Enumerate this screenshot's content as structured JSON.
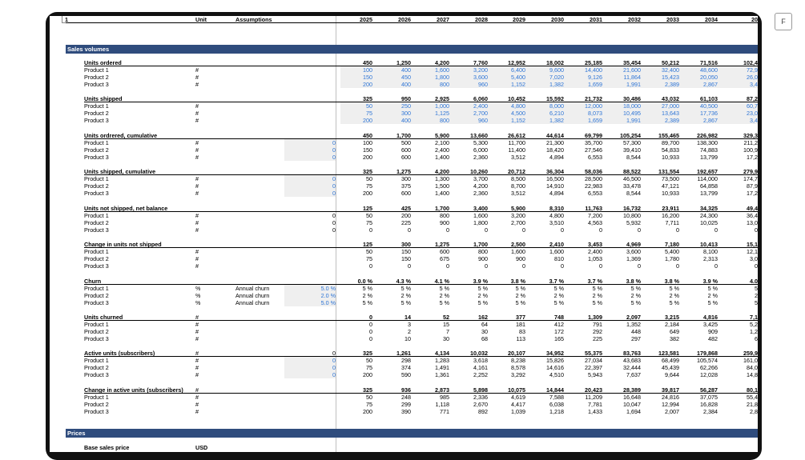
{
  "header": {
    "label0": "1",
    "unit": "Unit",
    "assumptions": "Assumptions",
    "years": [
      "2025",
      "2026",
      "2027",
      "2028",
      "2029",
      "2030",
      "2031",
      "2032",
      "2033",
      "2034",
      "20"
    ]
  },
  "toolbar": {
    "f_label": "F"
  },
  "sections": [
    {
      "label": "Sales volumes"
    },
    {
      "label": "Prices"
    }
  ],
  "blocks": [
    {
      "title": "Units ordered",
      "unit": "",
      "shade_assump": false,
      "shade_data": true,
      "values_blue": true,
      "total": [
        "450",
        "1,250",
        "4,200",
        "7,760",
        "12,952",
        "18,002",
        "25,185",
        "35,454",
        "50,212",
        "71,516",
        "102,4"
      ],
      "rows": [
        {
          "label": "Product 1",
          "unit": "#",
          "assump_label": "",
          "assump": "",
          "v": [
            "100",
            "400",
            "1,600",
            "3,200",
            "6,400",
            "9,600",
            "14,400",
            "21,600",
            "32,400",
            "48,600",
            "72,9"
          ]
        },
        {
          "label": "Product 2",
          "unit": "#",
          "assump_label": "",
          "assump": "",
          "v": [
            "150",
            "450",
            "1,800",
            "3,600",
            "5,400",
            "7,020",
            "9,126",
            "11,864",
            "15,423",
            "20,050",
            "26,0"
          ]
        },
        {
          "label": "Product 3",
          "unit": "#",
          "assump_label": "",
          "assump": "",
          "v": [
            "200",
            "400",
            "800",
            "960",
            "1,152",
            "1,382",
            "1,659",
            "1,991",
            "2,389",
            "2,867",
            "3,4"
          ]
        }
      ]
    },
    {
      "title": "Units shipped",
      "unit": "",
      "shade_assump": false,
      "shade_data": true,
      "values_blue": true,
      "total": [
        "325",
        "950",
        "2,925",
        "6,060",
        "10,452",
        "15,592",
        "21,732",
        "30,486",
        "43,032",
        "61,103",
        "87,2"
      ],
      "rows": [
        {
          "label": "Product 1",
          "unit": "#",
          "assump_label": "",
          "assump": "",
          "v": [
            "50",
            "250",
            "1,000",
            "2,400",
            "4,800",
            "8,000",
            "12,000",
            "18,000",
            "27,000",
            "40,500",
            "60,7"
          ]
        },
        {
          "label": "Product 2",
          "unit": "#",
          "assump_label": "",
          "assump": "",
          "v": [
            "75",
            "300",
            "1,125",
            "2,700",
            "4,500",
            "6,210",
            "8,073",
            "10,495",
            "13,643",
            "17,736",
            "23,0"
          ]
        },
        {
          "label": "Product 3",
          "unit": "#",
          "assump_label": "",
          "assump": "",
          "v": [
            "200",
            "400",
            "800",
            "960",
            "1,152",
            "1,382",
            "1,659",
            "1,991",
            "2,389",
            "2,867",
            "3,4"
          ]
        }
      ]
    },
    {
      "title": "Units ordrered, cumulative",
      "unit": "",
      "shade_assump": true,
      "shade_data": false,
      "values_blue": false,
      "total": [
        "450",
        "1,700",
        "5,900",
        "13,660",
        "26,612",
        "44,614",
        "69,799",
        "105,254",
        "155,465",
        "226,982",
        "329,3"
      ],
      "rows": [
        {
          "label": "Product 1",
          "unit": "#",
          "assump_label": "",
          "assump": "0",
          "v": [
            "100",
            "500",
            "2,100",
            "5,300",
            "11,700",
            "21,300",
            "35,700",
            "57,300",
            "89,700",
            "138,300",
            "211,2"
          ]
        },
        {
          "label": "Product 2",
          "unit": "#",
          "assump_label": "",
          "assump": "0",
          "v": [
            "150",
            "600",
            "2,400",
            "6,000",
            "11,400",
            "18,420",
            "27,546",
            "39,410",
            "54,833",
            "74,883",
            "100,9"
          ]
        },
        {
          "label": "Product 3",
          "unit": "#",
          "assump_label": "",
          "assump": "0",
          "v": [
            "200",
            "600",
            "1,400",
            "2,360",
            "3,512",
            "4,894",
            "6,553",
            "8,544",
            "10,933",
            "13,799",
            "17,2"
          ]
        }
      ]
    },
    {
      "title": "Units shipped, cumulative",
      "unit": "",
      "shade_assump": true,
      "shade_data": false,
      "values_blue": false,
      "total": [
        "325",
        "1,275",
        "4,200",
        "10,260",
        "20,712",
        "36,304",
        "58,036",
        "88,522",
        "131,554",
        "192,657",
        "279,9"
      ],
      "rows": [
        {
          "label": "Product 1",
          "unit": "#",
          "assump_label": "",
          "assump": "0",
          "v": [
            "50",
            "300",
            "1,300",
            "3,700",
            "8,500",
            "16,500",
            "28,500",
            "46,500",
            "73,500",
            "114,000",
            "174,7"
          ]
        },
        {
          "label": "Product 2",
          "unit": "#",
          "assump_label": "",
          "assump": "0",
          "v": [
            "75",
            "375",
            "1,500",
            "4,200",
            "8,700",
            "14,910",
            "22,983",
            "33,478",
            "47,121",
            "64,858",
            "87,9"
          ]
        },
        {
          "label": "Product 3",
          "unit": "#",
          "assump_label": "",
          "assump": "0",
          "v": [
            "200",
            "600",
            "1,400",
            "2,360",
            "3,512",
            "4,894",
            "6,553",
            "8,544",
            "10,933",
            "13,799",
            "17,2"
          ]
        }
      ]
    },
    {
      "title": "Units not shipped, net balance",
      "unit": "",
      "shade_assump": false,
      "shade_data": false,
      "values_blue": false,
      "total": [
        "125",
        "425",
        "1,700",
        "3,400",
        "5,900",
        "8,310",
        "11,763",
        "16,732",
        "23,911",
        "34,325",
        "49,4"
      ],
      "rows": [
        {
          "label": "Product 1",
          "unit": "#",
          "assump_label": "",
          "assump": "0",
          "v": [
            "50",
            "200",
            "800",
            "1,600",
            "3,200",
            "4,800",
            "7,200",
            "10,800",
            "16,200",
            "24,300",
            "36,4"
          ]
        },
        {
          "label": "Product 2",
          "unit": "#",
          "assump_label": "",
          "assump": "0",
          "v": [
            "75",
            "225",
            "900",
            "1,800",
            "2,700",
            "3,510",
            "4,563",
            "5,932",
            "7,711",
            "10,025",
            "13,0"
          ]
        },
        {
          "label": "Product 3",
          "unit": "#",
          "assump_label": "",
          "assump": "0",
          "v": [
            "0",
            "0",
            "0",
            "0",
            "0",
            "0",
            "0",
            "0",
            "0",
            "0",
            "0"
          ]
        }
      ]
    },
    {
      "title": "Change in units not shipped",
      "unit": "",
      "shade_assump": false,
      "shade_data": false,
      "values_blue": false,
      "total": [
        "125",
        "300",
        "1,275",
        "1,700",
        "2,500",
        "2,410",
        "3,453",
        "4,969",
        "7,180",
        "10,413",
        "15,1"
      ],
      "rows": [
        {
          "label": "Product 1",
          "unit": "#",
          "assump_label": "",
          "assump": "",
          "v": [
            "50",
            "150",
            "600",
            "800",
            "1,600",
            "1,600",
            "2,400",
            "3,600",
            "5,400",
            "8,100",
            "12,1"
          ]
        },
        {
          "label": "Product 2",
          "unit": "#",
          "assump_label": "",
          "assump": "",
          "v": [
            "75",
            "150",
            "675",
            "900",
            "900",
            "810",
            "1,053",
            "1,369",
            "1,780",
            "2,313",
            "3,0"
          ]
        },
        {
          "label": "Product 3",
          "unit": "#",
          "assump_label": "",
          "assump": "",
          "v": [
            "0",
            "0",
            "0",
            "0",
            "0",
            "0",
            "0",
            "0",
            "0",
            "0",
            "0"
          ]
        }
      ]
    },
    {
      "title": "Churn",
      "unit": "",
      "shade_assump": true,
      "shade_data": false,
      "values_blue": false,
      "total": [
        "0.0 %",
        "4.3 %",
        "4.1 %",
        "3.9 %",
        "3.8 %",
        "3.7 %",
        "3.7 %",
        "3.8 %",
        "3.8 %",
        "3.9 %",
        "4.0"
      ],
      "rows": [
        {
          "label": "Product 1",
          "unit": "%",
          "assump_label": "Annual churn",
          "assump": "5.0 %",
          "v": [
            "5 %",
            "5 %",
            "5 %",
            "5 %",
            "5 %",
            "5 %",
            "5 %",
            "5 %",
            "5 %",
            "5 %",
            "5"
          ]
        },
        {
          "label": "Product 2",
          "unit": "%",
          "assump_label": "Annual churn",
          "assump": "2.0 %",
          "v": [
            "2 %",
            "2 %",
            "2 %",
            "2 %",
            "2 %",
            "2 %",
            "2 %",
            "2 %",
            "2 %",
            "2 %",
            "2"
          ]
        },
        {
          "label": "Product 3",
          "unit": "%",
          "assump_label": "Annual churn",
          "assump": "5.0 %",
          "v": [
            "5 %",
            "5 %",
            "5 %",
            "5 %",
            "5 %",
            "5 %",
            "5 %",
            "5 %",
            "5 %",
            "5 %",
            "5"
          ]
        }
      ]
    },
    {
      "title": "Units churned",
      "unit": "#",
      "shade_assump": false,
      "shade_data": false,
      "values_blue": false,
      "total": [
        "0",
        "14",
        "52",
        "162",
        "377",
        "748",
        "1,309",
        "2,097",
        "3,215",
        "4,816",
        "7,1"
      ],
      "rows": [
        {
          "label": "Product 1",
          "unit": "#",
          "assump_label": "",
          "assump": "",
          "v": [
            "0",
            "3",
            "15",
            "64",
            "181",
            "412",
            "791",
            "1,352",
            "2,184",
            "3,425",
            "5,2"
          ]
        },
        {
          "label": "Product 2",
          "unit": "#",
          "assump_label": "",
          "assump": "",
          "v": [
            "0",
            "2",
            "7",
            "30",
            "83",
            "172",
            "292",
            "448",
            "649",
            "909",
            "1,2"
          ]
        },
        {
          "label": "Product 3",
          "unit": "#",
          "assump_label": "",
          "assump": "",
          "v": [
            "0",
            "10",
            "30",
            "68",
            "113",
            "165",
            "225",
            "297",
            "382",
            "482",
            "6"
          ]
        }
      ]
    },
    {
      "title": "Active units (subscribers)",
      "unit": "#",
      "shade_assump": true,
      "shade_data": false,
      "values_blue": false,
      "total_assump": "0",
      "total": [
        "325",
        "1,261",
        "4,134",
        "10,032",
        "20,107",
        "34,952",
        "55,375",
        "83,763",
        "123,581",
        "179,868",
        "259,9"
      ],
      "rows": [
        {
          "label": "Product 1",
          "unit": "#",
          "assump_label": "",
          "assump": "0",
          "v": [
            "50",
            "298",
            "1,283",
            "3,618",
            "8,238",
            "15,826",
            "27,034",
            "43,683",
            "68,499",
            "105,574",
            "161,0"
          ]
        },
        {
          "label": "Product 2",
          "unit": "#",
          "assump_label": "",
          "assump": "0",
          "v": [
            "75",
            "374",
            "1,491",
            "4,161",
            "8,578",
            "14,616",
            "22,397",
            "32,444",
            "45,439",
            "62,266",
            "84,0"
          ]
        },
        {
          "label": "Product 3",
          "unit": "#",
          "assump_label": "",
          "assump": "0",
          "v": [
            "200",
            "590",
            "1,361",
            "2,252",
            "3,292",
            "4,510",
            "5,943",
            "7,637",
            "9,644",
            "12,028",
            "14,8"
          ]
        }
      ]
    },
    {
      "title": "Change in active units (subscribers)",
      "unit": "#",
      "shade_assump": false,
      "shade_data": false,
      "values_blue": false,
      "total": [
        "325",
        "936",
        "2,873",
        "5,898",
        "10,075",
        "14,844",
        "20,423",
        "28,389",
        "39,817",
        "56,287",
        "80,1"
      ],
      "rows": [
        {
          "label": "Product 1",
          "unit": "#",
          "assump_label": "",
          "assump": "",
          "v": [
            "50",
            "248",
            "985",
            "2,336",
            "4,619",
            "7,588",
            "11,209",
            "16,648",
            "24,816",
            "37,075",
            "55,4"
          ]
        },
        {
          "label": "Product 2",
          "unit": "#",
          "assump_label": "",
          "assump": "",
          "v": [
            "75",
            "299",
            "1,118",
            "2,670",
            "4,417",
            "6,038",
            "7,781",
            "10,047",
            "12,994",
            "16,828",
            "21,8"
          ]
        },
        {
          "label": "Product 3",
          "unit": "#",
          "assump_label": "",
          "assump": "",
          "v": [
            "200",
            "390",
            "771",
            "892",
            "1,039",
            "1,218",
            "1,433",
            "1,694",
            "2,007",
            "2,384",
            "2,8"
          ]
        }
      ]
    }
  ],
  "prices": {
    "first_row_label": "Base sales price",
    "first_row_unit": "USD"
  },
  "colors": {
    "section_bar": "#2f4c7d",
    "input_blue": "#2e75d6",
    "shade": "#efefef"
  }
}
